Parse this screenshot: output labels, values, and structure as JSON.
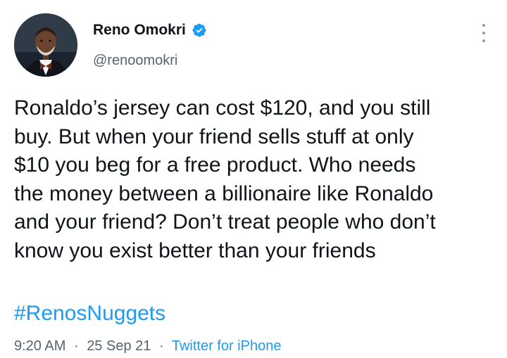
{
  "author": {
    "display_name": "Reno Omokri",
    "handle": "@renoomokri",
    "verified_icon": "verified-badge-icon",
    "verified_color": "#1d9bf0"
  },
  "tweet": {
    "lines": [
      "Ronaldo’s jersey can cost $120, and you still",
      "buy. But when your friend sells stuff at only",
      "$10 you beg for a free product. Who needs",
      "the money between a billionaire like Ronaldo",
      "and your friend? Don’t treat people who don’t",
      "know you exist better than your friends"
    ],
    "hashtag": "#RenosNuggets"
  },
  "meta": {
    "time": "9:20 AM",
    "separator": "·",
    "date": "25 Sep 21",
    "source": "Twitter for iPhone"
  },
  "colors": {
    "text": "#0f1419",
    "secondary": "#536471",
    "link": "#1d9bf0"
  }
}
